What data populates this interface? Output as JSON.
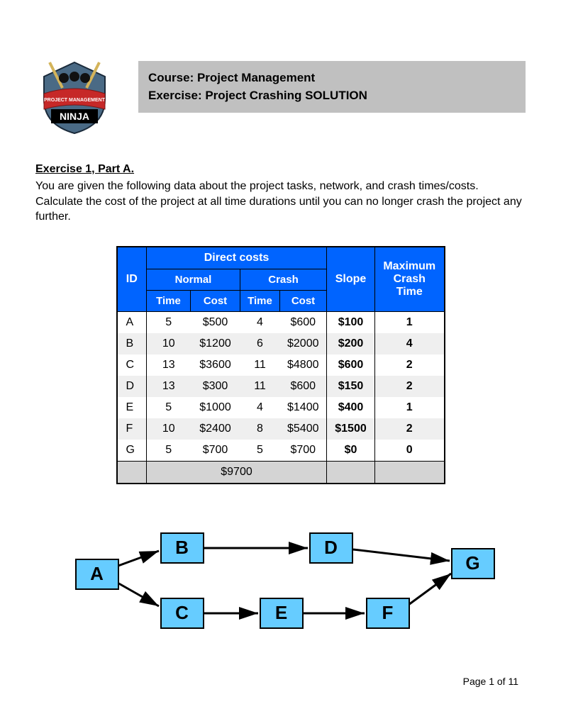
{
  "header": {
    "course_line": "Course: Project Management",
    "exercise_line": "Exercise: Project Crashing SOLUTION",
    "logo_banner": "PROJECT MANAGEMENT",
    "logo_main": "NINJA"
  },
  "exercise": {
    "title": "Exercise 1, Part A.",
    "text": "You are given the following data about the project tasks, network, and crash times/costs. Calculate the cost of the project at all time durations until you can no longer crash the project any further."
  },
  "table": {
    "hdr_direct": "Direct costs",
    "hdr_normal": "Normal",
    "hdr_crash": "Crash",
    "hdr_id": "ID",
    "hdr_time": "Time",
    "hdr_cost": "Cost",
    "hdr_slope": "Slope",
    "hdr_max": "Maximum Crash Time",
    "rows": [
      {
        "id": "A",
        "ntime": "5",
        "ncost": "$500",
        "ctime": "4",
        "ccost": "$600",
        "slope": "$100",
        "max": "1"
      },
      {
        "id": "B",
        "ntime": "10",
        "ncost": "$1200",
        "ctime": "6",
        "ccost": "$2000",
        "slope": "$200",
        "max": "4"
      },
      {
        "id": "C",
        "ntime": "13",
        "ncost": "$3600",
        "ctime": "11",
        "ccost": "$4800",
        "slope": "$600",
        "max": "2"
      },
      {
        "id": "D",
        "ntime": "13",
        "ncost": "$300",
        "ctime": "11",
        "ccost": "$600",
        "slope": "$150",
        "max": "2"
      },
      {
        "id": "E",
        "ntime": "5",
        "ncost": "$1000",
        "ctime": "4",
        "ccost": "$1400",
        "slope": "$400",
        "max": "1"
      },
      {
        "id": "F",
        "ntime": "10",
        "ncost": "$2400",
        "ctime": "8",
        "ccost": "$5400",
        "slope": "$1500",
        "max": "2"
      },
      {
        "id": "G",
        "ntime": "5",
        "ncost": "$700",
        "ctime": "5",
        "ccost": "$700",
        "slope": "$0",
        "max": "0"
      }
    ],
    "total": "$9700"
  },
  "nodes": {
    "A": "A",
    "B": "B",
    "C": "C",
    "D": "D",
    "E": "E",
    "F": "F",
    "G": "G"
  },
  "footer": "Page 1 of 11"
}
